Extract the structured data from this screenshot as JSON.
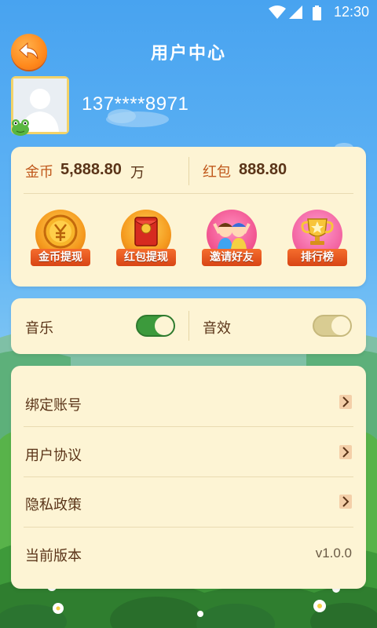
{
  "status_bar": {
    "time": "12:30",
    "icons": [
      "wifi-icon",
      "signal-icon",
      "battery-icon"
    ]
  },
  "header": {
    "title": "用户中心",
    "back_icon": "back-arrow-icon"
  },
  "user": {
    "phone": "137****8971",
    "avatar_icon": "default-avatar-icon"
  },
  "balance": {
    "gold_label": "金币",
    "gold_value": "5,888.80",
    "gold_unit": "万",
    "red_label": "红包",
    "red_value": "888.80"
  },
  "actions": [
    {
      "label": "金币提现",
      "icon": "gold-coin-icon"
    },
    {
      "label": "红包提现",
      "icon": "red-envelope-icon"
    },
    {
      "label": "邀请好友",
      "icon": "friends-icon"
    },
    {
      "label": "排行榜",
      "icon": "trophy-icon"
    }
  ],
  "settings": {
    "music_label": "音乐",
    "music_on": true,
    "sound_label": "音效",
    "sound_on": false
  },
  "menu": {
    "bind_account": "绑定账号",
    "user_agreement": "用户协议",
    "privacy_policy": "隐私政策",
    "version_label": "当前版本",
    "version_value": "v1.0.0"
  },
  "colors": {
    "accent_orange": "#ff8a1d",
    "toggle_on": "#3c9a3c",
    "toggle_off": "#d9cc92",
    "card_bg": "#fdf4d4",
    "label_brown": "#c0581b"
  }
}
